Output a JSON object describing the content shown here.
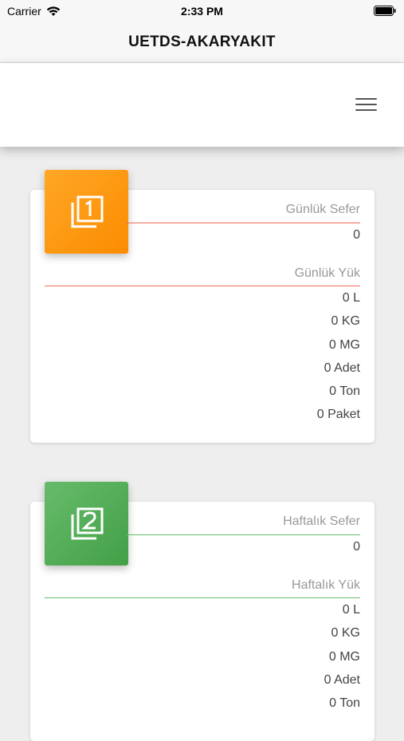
{
  "status": {
    "carrier": "Carrier",
    "time": "2:33 PM"
  },
  "nav": {
    "title": "UETDS-AKARYAKIT"
  },
  "colors": {
    "orange": "#fb8c00",
    "green": "#43a047"
  },
  "cards": [
    {
      "icon": "filter-1-icon",
      "trip_label": "Günlük Sefer",
      "trip_value": "0",
      "load_label": "Günlük Yük",
      "loads": [
        "0 L",
        "0 KG",
        "0 MG",
        "0 Adet",
        "0 Ton",
        "0 Paket"
      ]
    },
    {
      "icon": "filter-2-icon",
      "trip_label": "Haftalık Sefer",
      "trip_value": "0",
      "load_label": "Haftalık Yük",
      "loads": [
        "0 L",
        "0 KG",
        "0 MG",
        "0 Adet",
        "0 Ton"
      ]
    }
  ]
}
